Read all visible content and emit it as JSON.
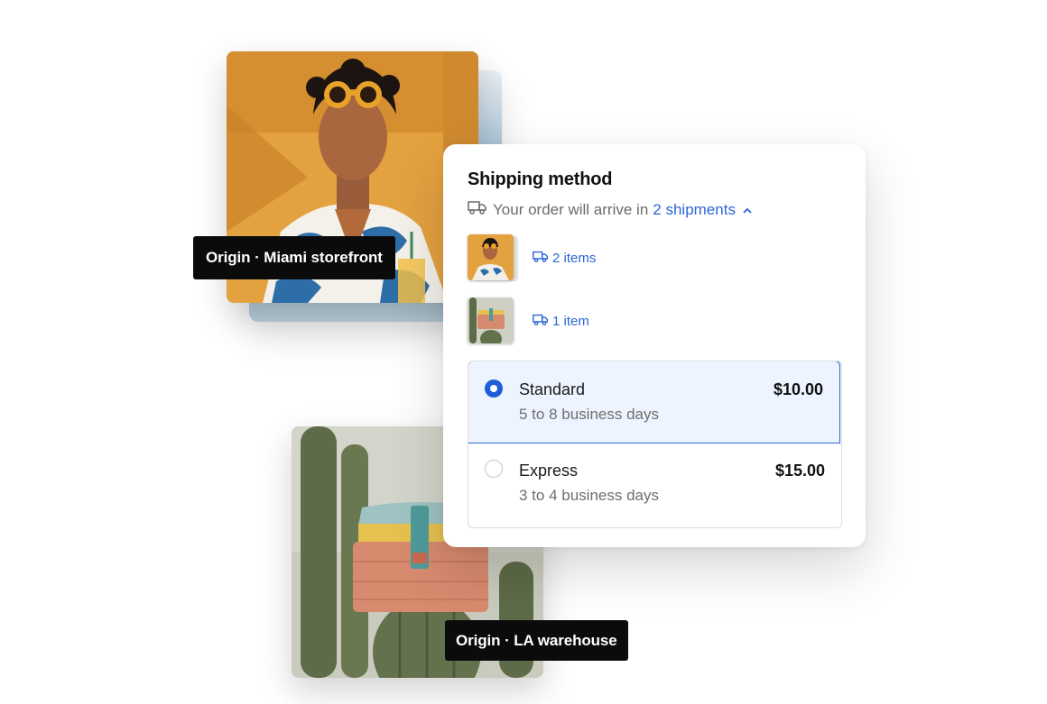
{
  "origins": {
    "miami_label": "Origin · Miami storefront",
    "la_label": "Origin · LA warehouse"
  },
  "shipping": {
    "title": "Shipping method",
    "arrive_prefix": "Your order will arrive in",
    "shipments_link": "2 shipments",
    "shipments": [
      {
        "label": "2 items"
      },
      {
        "label": "1 item"
      }
    ],
    "options": [
      {
        "name": "Standard",
        "detail": "5 to 8 business days",
        "price": "$10.00",
        "selected": true
      },
      {
        "name": "Express",
        "detail": "3 to 4 business days",
        "price": "$15.00",
        "selected": false
      }
    ]
  },
  "colors": {
    "accent": "#2b66d6",
    "selected_bg": "#eef4ff",
    "tag_bg": "#0b0b0b"
  },
  "icons": [
    "truck-icon",
    "chevron-up-icon"
  ]
}
